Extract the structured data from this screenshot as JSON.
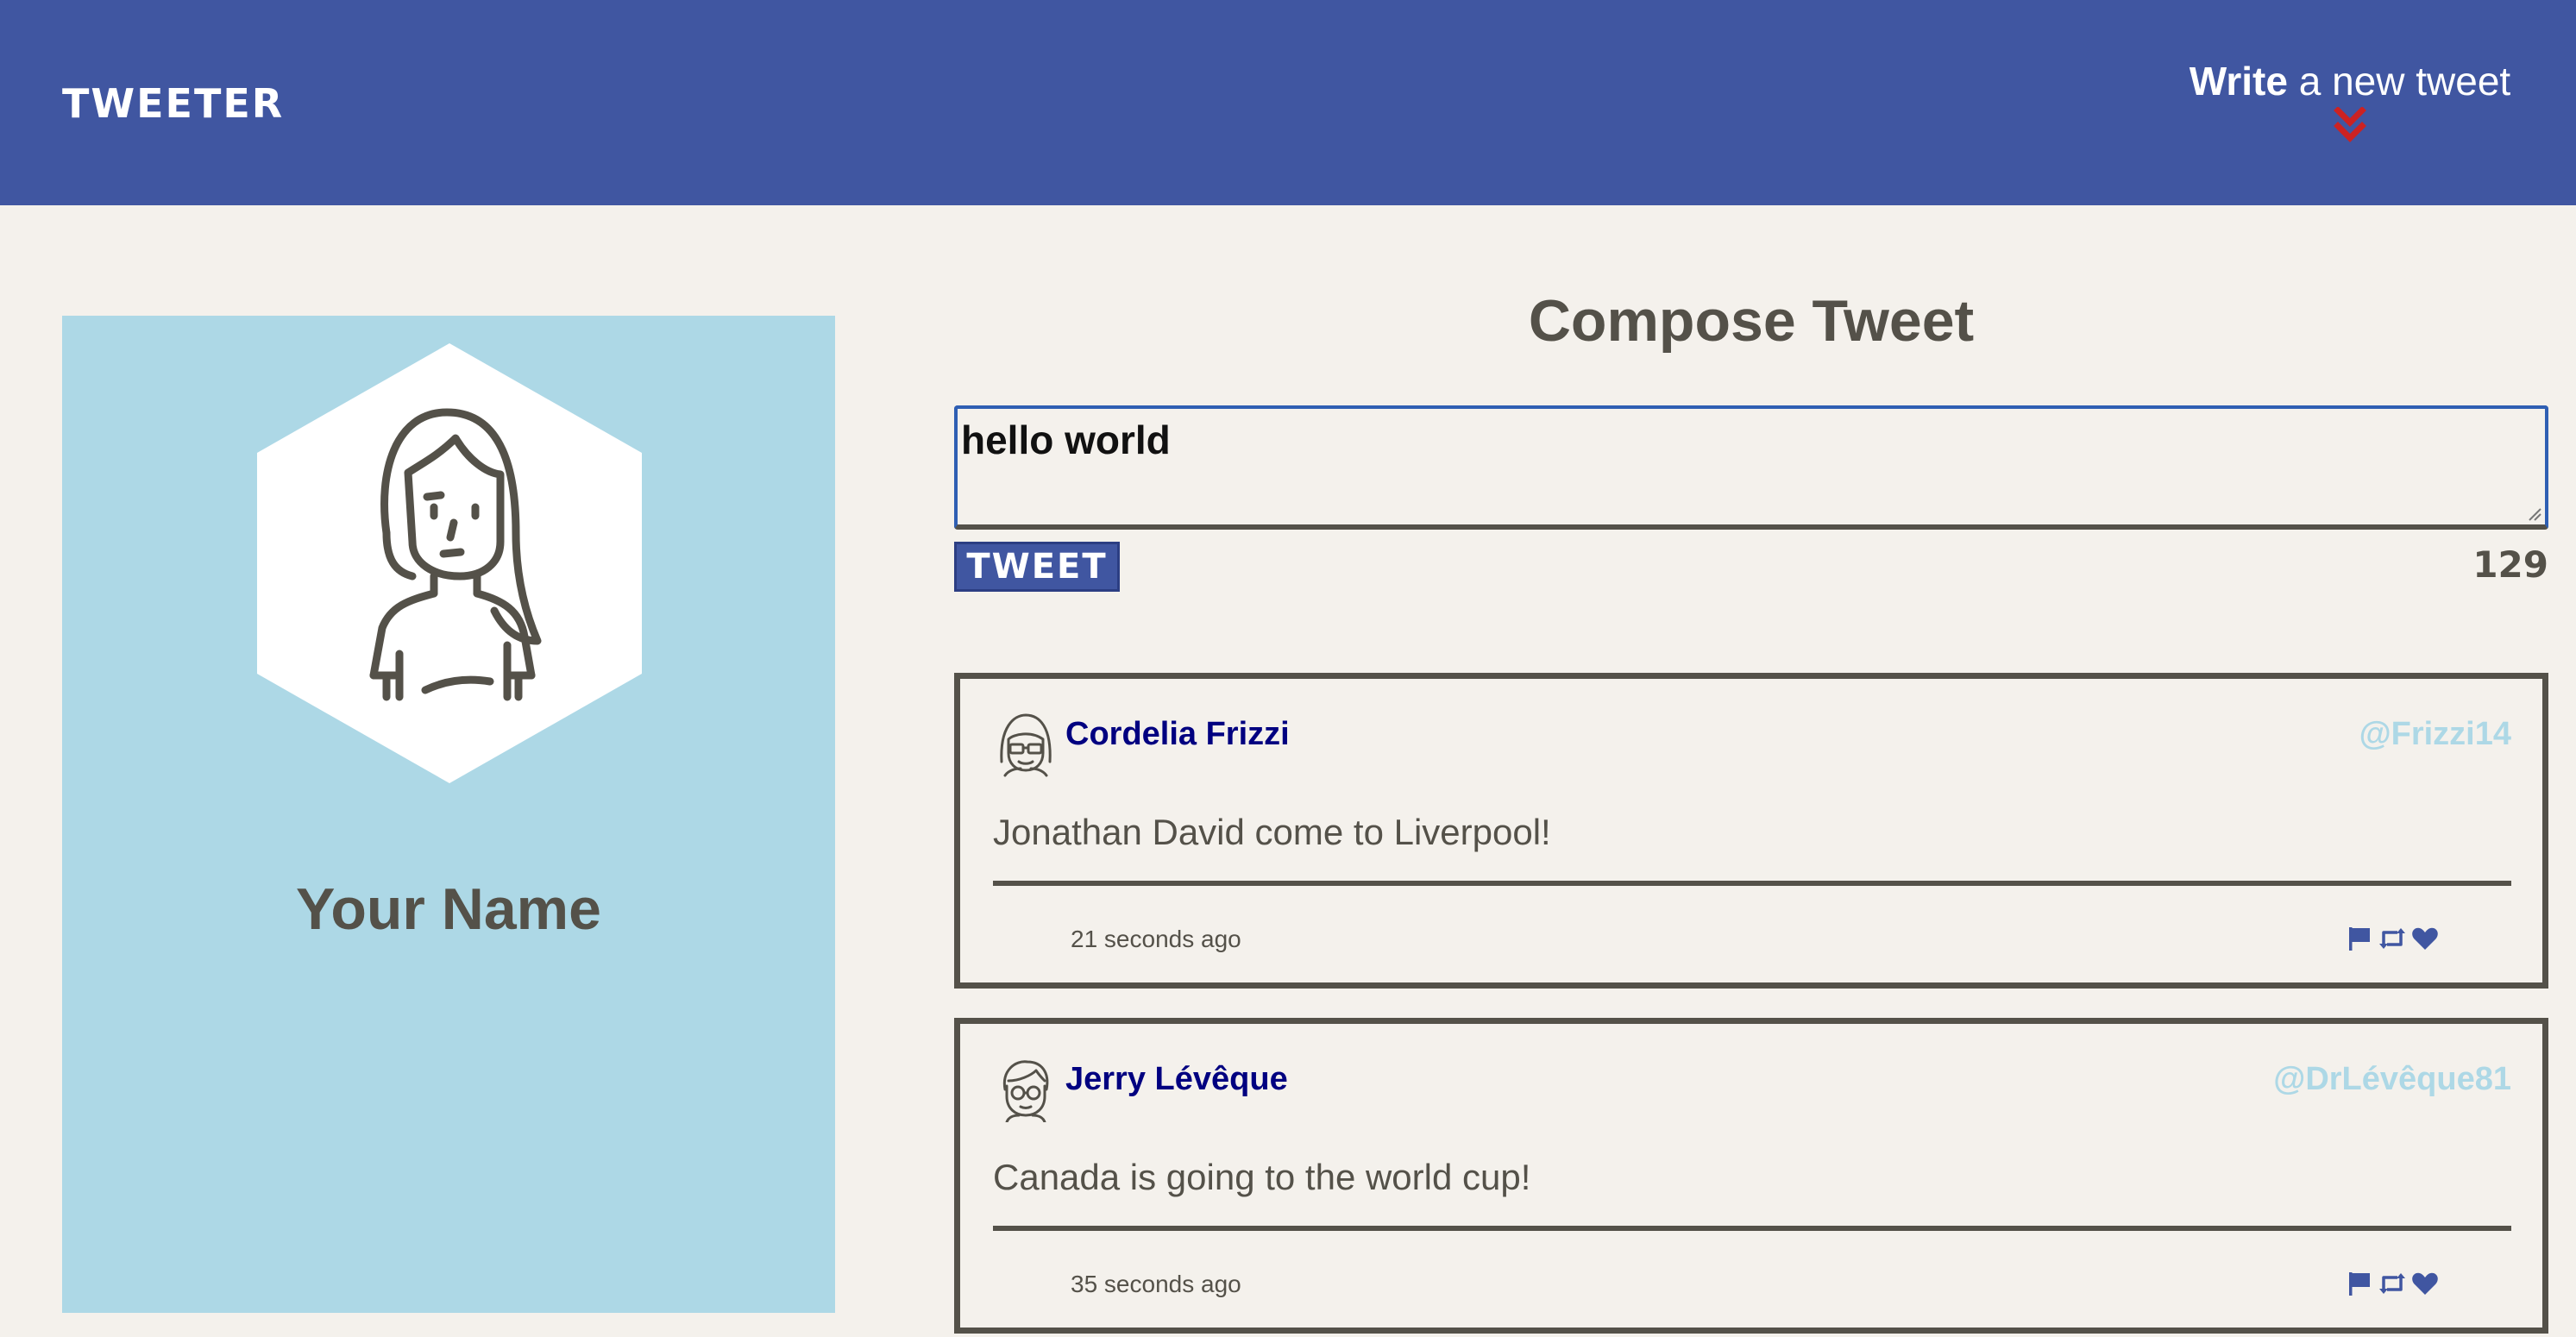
{
  "nav": {
    "brand": "TWEETER",
    "write_bold": "Write",
    "write_rest": " a new tweet",
    "toggle_icon": "double-chevron-down-icon",
    "accent_color": "#cc2222"
  },
  "profile": {
    "avatar_icon": "woman-avatar-icon",
    "name": "Your Name"
  },
  "compose": {
    "title": "Compose Tweet",
    "input_value": "hello world",
    "button_label": "TWEET",
    "counter": "129"
  },
  "tweets": [
    {
      "avatar_icon": "avatar-glasses-icon",
      "name": "Cordelia Frizzi",
      "handle": "@Frizzi14",
      "content": "Jonathan David come to Liverpool!",
      "time": "21 seconds ago",
      "actions": [
        "flag-icon",
        "retweet-icon",
        "heart-icon"
      ]
    },
    {
      "avatar_icon": "avatar-man-glasses-icon",
      "name": "Jerry Lévêque",
      "handle": "@DrLévêque81",
      "content": "Canada is going to the world cup!",
      "time": "35 seconds ago",
      "actions": [
        "flag-icon",
        "retweet-icon",
        "heart-icon"
      ]
    }
  ],
  "colors": {
    "nav_bg": "#4056a1",
    "page_bg": "#f4f1ec",
    "profile_bg": "#add8e6",
    "text": "#545149",
    "tweet_name": "#000080",
    "tweet_handle": "#add8e6"
  }
}
